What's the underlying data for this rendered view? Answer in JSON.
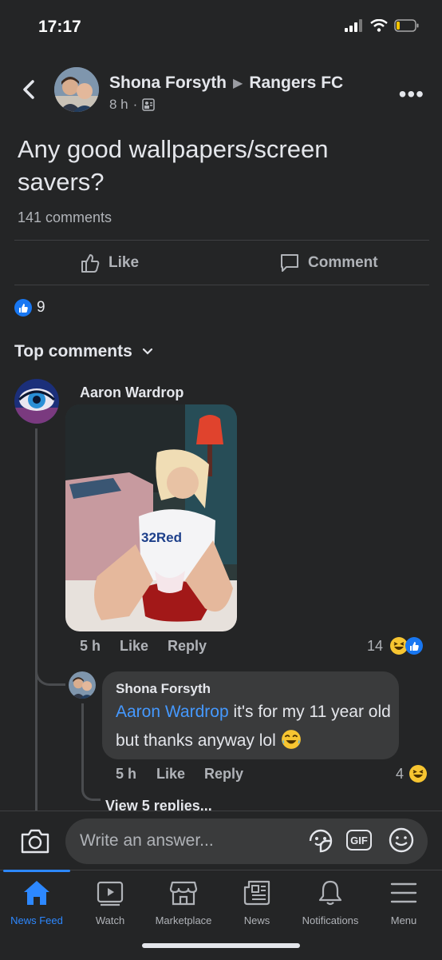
{
  "status_bar": {
    "time": "17:17"
  },
  "post": {
    "author": "Shona Forsyth",
    "group": "Rangers FC",
    "time": "8 h",
    "text": "Any good wallpapers/screen savers?",
    "comment_count": "141 comments",
    "like_label": "Like",
    "comment_label": "Comment",
    "reaction_count": "9"
  },
  "top_comments": {
    "label": "Top comments"
  },
  "comment": {
    "author": "Aaron Wardrop",
    "time": "5 h",
    "like_label": "Like",
    "reply_label": "Reply",
    "reaction_count": "14"
  },
  "reply": {
    "author": "Shona Forsyth",
    "mention": "Aaron Wardrop",
    "text": "it's for my 11 year old but thanks anyway lol",
    "time": "5 h",
    "like_label": "Like",
    "reply_label": "Reply",
    "reaction_count": "4"
  },
  "view_replies": "View 5 replies...",
  "composer": {
    "placeholder": "Write an answer..."
  },
  "tabs": [
    {
      "label": "News Feed",
      "icon": "home-icon"
    },
    {
      "label": "Watch",
      "icon": "watch-icon"
    },
    {
      "label": "Marketplace",
      "icon": "marketplace-icon"
    },
    {
      "label": "News",
      "icon": "news-icon"
    },
    {
      "label": "Notifications",
      "icon": "bell-icon"
    },
    {
      "label": "Menu",
      "icon": "menu-icon"
    }
  ],
  "colors": {
    "background": "#242526",
    "accent": "#2d88ff",
    "bubble": "#3a3b3c",
    "muted_text": "#b0b3b8"
  }
}
